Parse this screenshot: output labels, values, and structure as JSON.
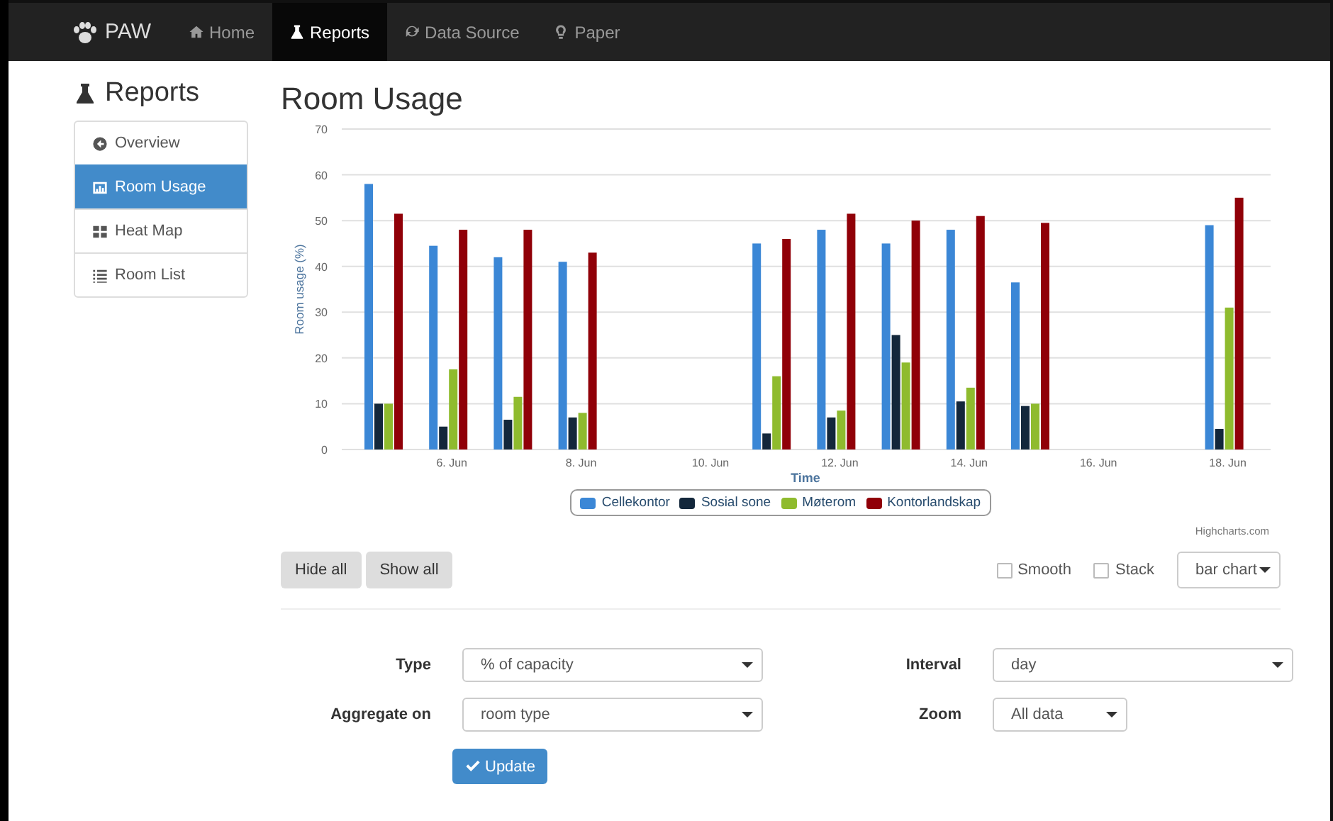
{
  "navbar": {
    "brand": "PAW",
    "items": [
      {
        "label": "Home",
        "selected": false
      },
      {
        "label": "Reports",
        "selected": true
      },
      {
        "label": "Data Source",
        "selected": false
      },
      {
        "label": "Paper",
        "selected": false
      }
    ]
  },
  "sidebar": {
    "title": "Reports",
    "items": [
      {
        "label": "Overview",
        "selected": false
      },
      {
        "label": "Room Usage",
        "selected": true
      },
      {
        "label": "Heat Map",
        "selected": false
      },
      {
        "label": "Room List",
        "selected": false
      }
    ]
  },
  "page_title": "Room Usage",
  "chart": {
    "chart_data": {
      "type": "bar",
      "xlabel": "Time",
      "ylabel": "Room usage (%)",
      "categories": [
        null,
        "6. Jun",
        null,
        "8. Jun",
        null,
        "10. Jun",
        null,
        "12. Jun",
        null,
        "14. Jun",
        null,
        "16. Jun",
        null,
        "18. Jun"
      ],
      "grid": true,
      "series": [
        {
          "name": "Cellekontor",
          "color": "#3b87d6",
          "values": [
            58,
            44.5,
            42,
            41,
            null,
            null,
            45,
            48,
            45,
            48,
            36.5,
            null,
            null,
            49
          ]
        },
        {
          "name": "Sosial sone",
          "color": "#13273b",
          "values": [
            10,
            5,
            6.5,
            7,
            null,
            null,
            3.5,
            7,
            25,
            10.5,
            9.5,
            null,
            null,
            4.5
          ]
        },
        {
          "name": "Møterom",
          "color": "#8fbb2e",
          "values": [
            10,
            17.5,
            11.5,
            8,
            null,
            null,
            16,
            8.5,
            19,
            13.5,
            10,
            null,
            null,
            31
          ]
        },
        {
          "name": "Kontorlandskap",
          "color": "#900008",
          "values": [
            51.5,
            48,
            48,
            43,
            null,
            null,
            46,
            51.5,
            50,
            51,
            49.5,
            null,
            null,
            55
          ]
        }
      ],
      "ylim": [
        0,
        70
      ],
      "yticks": [
        0,
        10,
        20,
        30,
        40,
        50,
        60,
        70
      ]
    },
    "credit": "Highcharts.com"
  },
  "controls": {
    "buttons": [
      "Hide all",
      "Show all"
    ],
    "options": [
      {
        "label": "Smooth",
        "checked": false
      },
      {
        "label": "Stack",
        "checked": false
      }
    ],
    "chart_type": "bar chart"
  },
  "form": {
    "fields": [
      {
        "label": "Type",
        "value": "% of capacity"
      },
      {
        "label": "Interval",
        "value": "day"
      },
      {
        "label": "Aggregate on",
        "value": "room type"
      },
      {
        "label": "Zoom",
        "value": "All data"
      }
    ],
    "submit": "Update"
  }
}
